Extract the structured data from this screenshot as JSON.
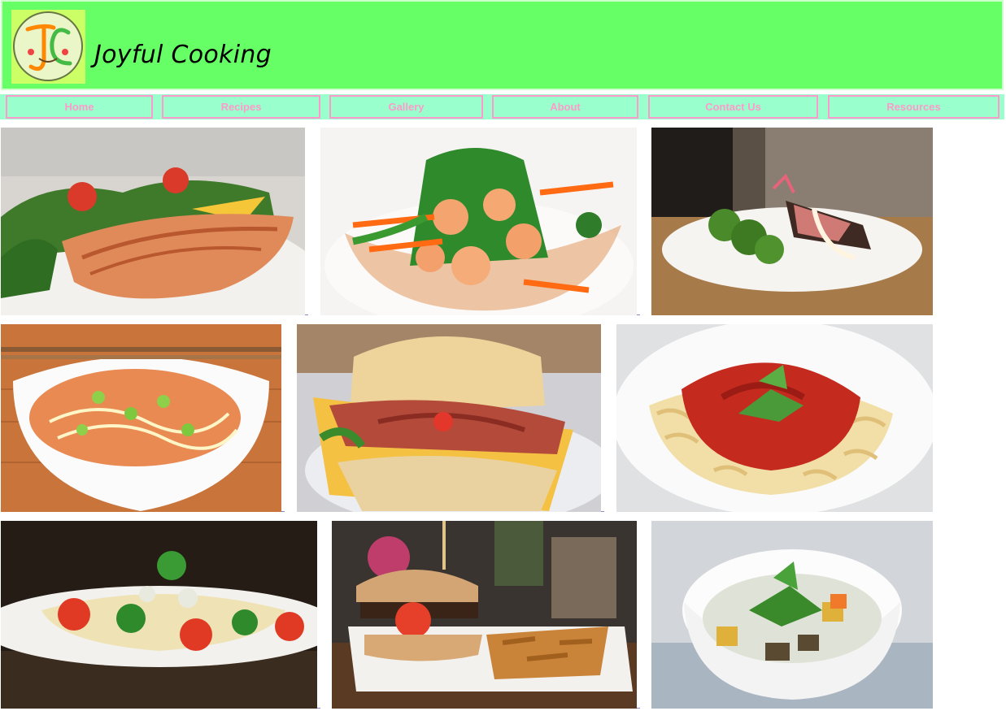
{
  "header": {
    "site_title": "Joyful Cooking",
    "logo_letters": "JC",
    "background_color": "#66ff66",
    "logo_background": "#ccff66"
  },
  "nav": {
    "items": [
      {
        "label": "Home"
      },
      {
        "label": "Recipes"
      },
      {
        "label": "Gallery"
      },
      {
        "label": "About"
      },
      {
        "label": "Contact Us"
      },
      {
        "label": "Resources"
      }
    ],
    "background_color": "#99ffcc",
    "accent_color": "#ff99cc"
  },
  "gallery": {
    "photos": [
      {
        "subject": "grilled salmon with salad"
      },
      {
        "subject": "shrimp and vegetable stir fry"
      },
      {
        "subject": "seared meat with broccoli"
      },
      {
        "subject": "rice bowl with scallions and chopsticks"
      },
      {
        "subject": "biscuit sandwich with bacon and cheese"
      },
      {
        "subject": "fusilli pasta with tomato sauce"
      },
      {
        "subject": "spaghetti with broccoli and tomatoes"
      },
      {
        "subject": "burger with potato wedges"
      },
      {
        "subject": "noodle bowl with vegetables"
      }
    ]
  }
}
